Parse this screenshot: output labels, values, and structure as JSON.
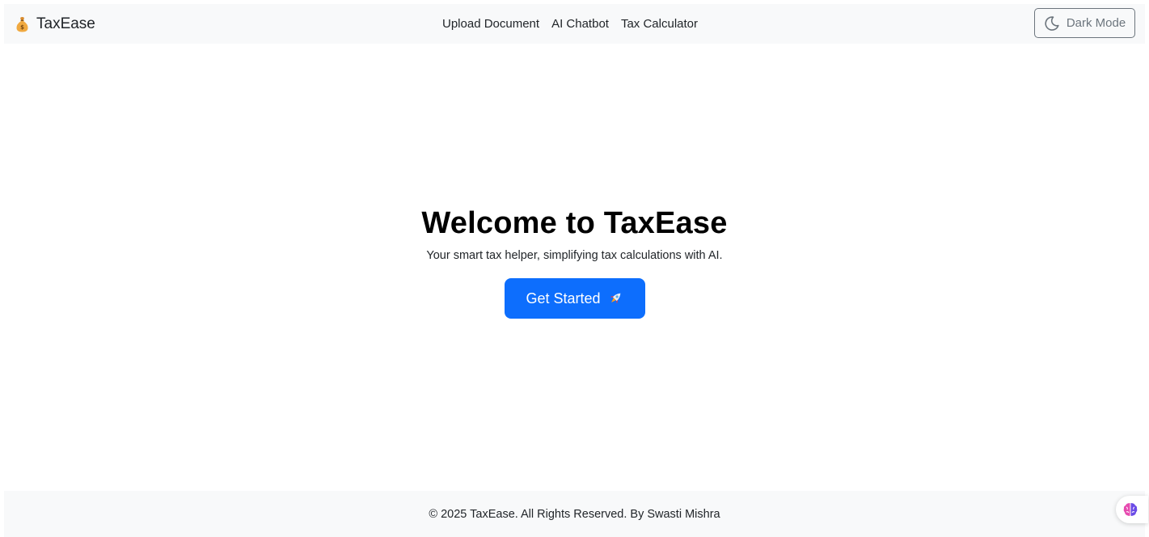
{
  "navbar": {
    "brand": {
      "icon": "money-bag-icon",
      "label": "TaxEase"
    },
    "links": [
      {
        "label": "Upload Document"
      },
      {
        "label": "AI Chatbot"
      },
      {
        "label": "Tax Calculator"
      }
    ],
    "theme_toggle": {
      "icon": "moon-icon",
      "label": "Dark Mode"
    }
  },
  "hero": {
    "title": "Welcome to TaxEase",
    "subtitle": "Your smart tax helper, simplifying tax calculations with AI.",
    "cta": {
      "label": "Get Started",
      "icon": "rocket-icon"
    }
  },
  "footer": {
    "text": "© 2025 TaxEase. All Rights Reserved. By Swasti Mishra"
  },
  "floating_widget": {
    "icon": "brain-icon"
  },
  "colors": {
    "navbar_bg": "#f8f9fa",
    "primary": "#0d6efd",
    "secondary": "#6c757d",
    "text": "#212529"
  }
}
